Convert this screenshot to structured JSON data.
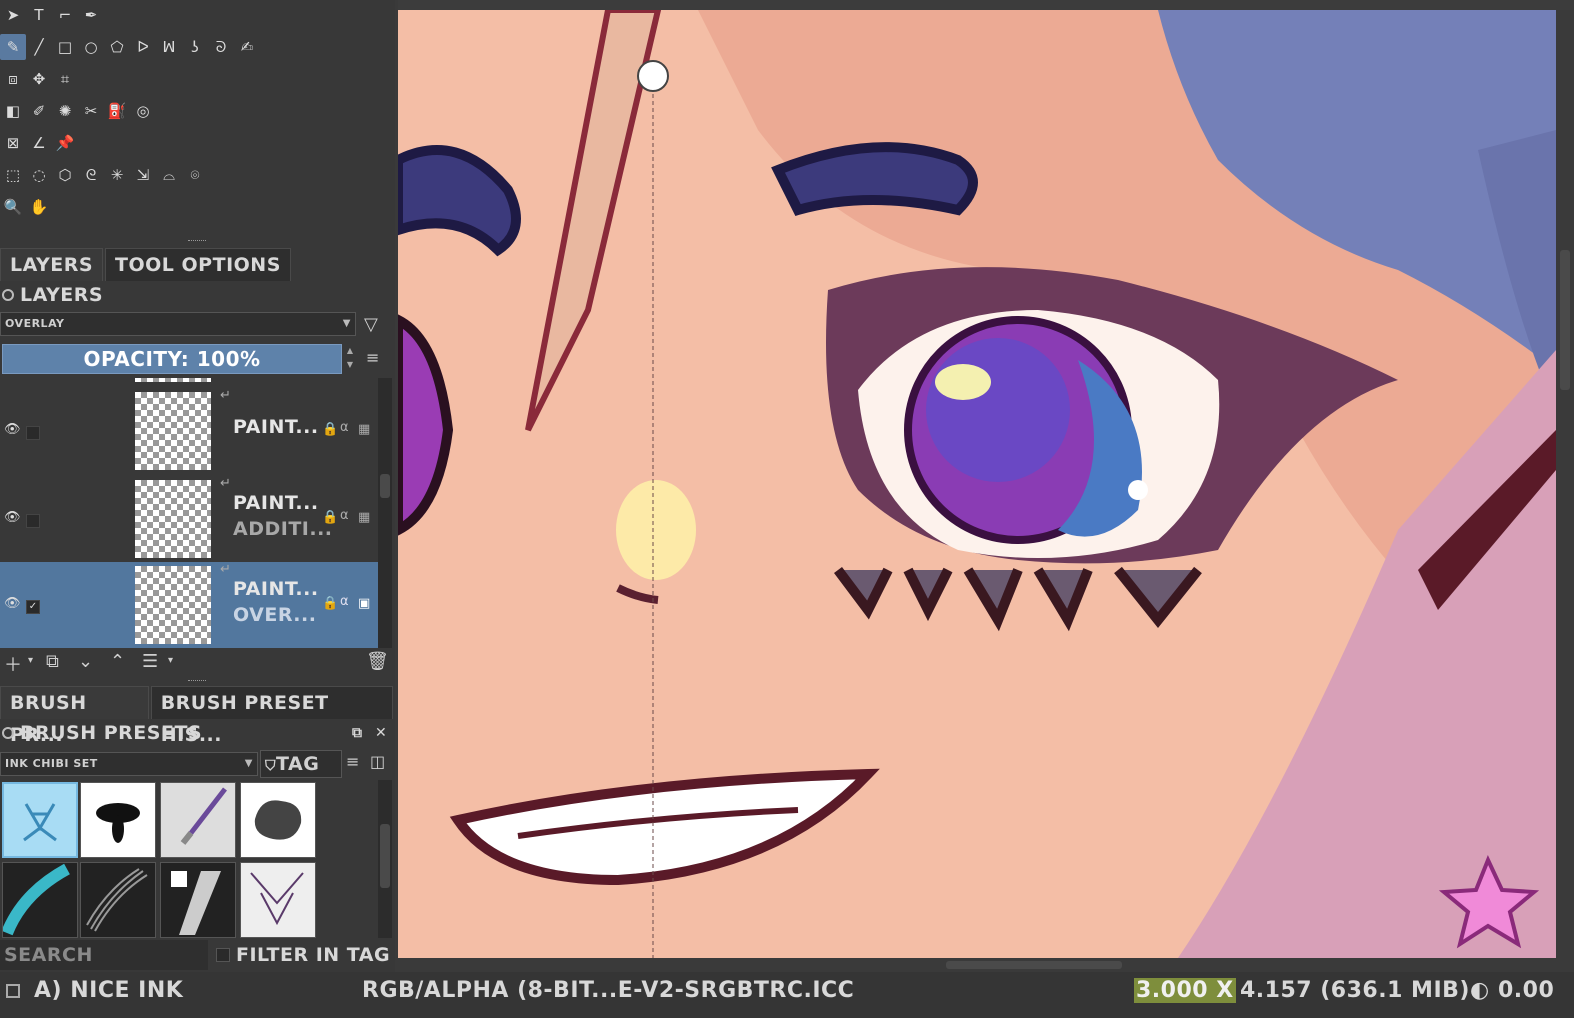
{
  "toolbox": {
    "rows": [
      [
        "select-shapes-icon",
        "text-icon",
        "edit-shapes-icon",
        "calligraphy-icon"
      ],
      [
        "freehand-brush-icon",
        "line-icon",
        "rectangle-icon",
        "ellipse-icon",
        "polygon-icon",
        "polyline-icon",
        "bezier-icon",
        "freehand-path-icon",
        "dynamic-brush-icon",
        "multibrush-icon"
      ],
      [
        "transform-icon",
        "move-icon",
        "crop-icon"
      ],
      [
        "gradient-icon",
        "color-picker-icon",
        "colorize-mask-icon",
        "smart-patch-icon",
        "fill-icon",
        "enclose-fill-icon"
      ],
      [
        "assistant-icon",
        "measure-icon",
        "reference-pin-icon"
      ],
      [
        "rect-select-icon",
        "ellipse-select-icon",
        "polygon-select-icon",
        "freehand-select-icon",
        "contiguous-select-icon",
        "similar-select-icon",
        "bezier-select-icon",
        "magnetic-select-icon"
      ],
      [
        "zoom-icon",
        "pan-icon"
      ]
    ],
    "glyphs": {
      "select-shapes-icon": "➤",
      "text-icon": "T",
      "edit-shapes-icon": "⌐",
      "calligraphy-icon": "✒",
      "freehand-brush-icon": "✎",
      "line-icon": "╱",
      "rectangle-icon": "□",
      "ellipse-icon": "○",
      "polygon-icon": "⬠",
      "polyline-icon": "ᐅ",
      "bezier-icon": "ꟽ",
      "freehand-path-icon": "ʖ",
      "dynamic-brush-icon": "ᘐ",
      "multibrush-icon": "✍",
      "transform-icon": "⧈",
      "move-icon": "✥",
      "crop-icon": "⌗",
      "gradient-icon": "◧",
      "color-picker-icon": "✐",
      "colorize-mask-icon": "✺",
      "smart-patch-icon": "✂",
      "fill-icon": "⛽",
      "enclose-fill-icon": "◎",
      "assistant-icon": "⊠",
      "measure-icon": "∠",
      "reference-pin-icon": "📌",
      "rect-select-icon": "⬚",
      "ellipse-select-icon": "◌",
      "polygon-select-icon": "⬡",
      "freehand-select-icon": "ᘓ",
      "contiguous-select-icon": "✳",
      "similar-select-icon": "⇲",
      "bezier-select-icon": "⌓",
      "magnetic-select-icon": "⌾",
      "zoom-icon": "🔍",
      "pan-icon": "✋"
    }
  },
  "tabs": {
    "layers": "Layers",
    "tool_options": "Tool Options"
  },
  "layers_panel": {
    "title": "Layers",
    "blend_mode": "Overlay",
    "opacity": "Opacity:  100%",
    "layers": [
      {
        "name": "Paint...",
        "blend": "",
        "visible": true,
        "checked": false
      },
      {
        "name": "Paint...",
        "blend": "Additi...",
        "visible": true,
        "checked": false
      },
      {
        "name": "Paint...",
        "blend": "Over...",
        "visible": true,
        "checked": true,
        "selected": true
      }
    ]
  },
  "brush_tabs": {
    "presets": "Brush Pr...",
    "history": "Brush Preset His..."
  },
  "brush_panel": {
    "title": "Brush Presets",
    "tag_combo": "Ink Chibi Set",
    "tag_label": "Tag",
    "search_placeholder": "Search",
    "filter_in_tag": "Filter in Tag"
  },
  "status": {
    "brush_name": "a) Nice Ink",
    "color_profile": "RGB/Alpha (8-bit...e-V2-srgbtrc.icc",
    "zoom_prefix": "3.000 x",
    "dimensions": "4.157 (636.1 MiB)",
    "rotation": "0.00"
  },
  "colors": {
    "accent": "#5e82aa",
    "panel_bg": "#383838",
    "skin": "#f2bba2",
    "hair": "#7480b8",
    "eye": "#8a3cb4"
  }
}
